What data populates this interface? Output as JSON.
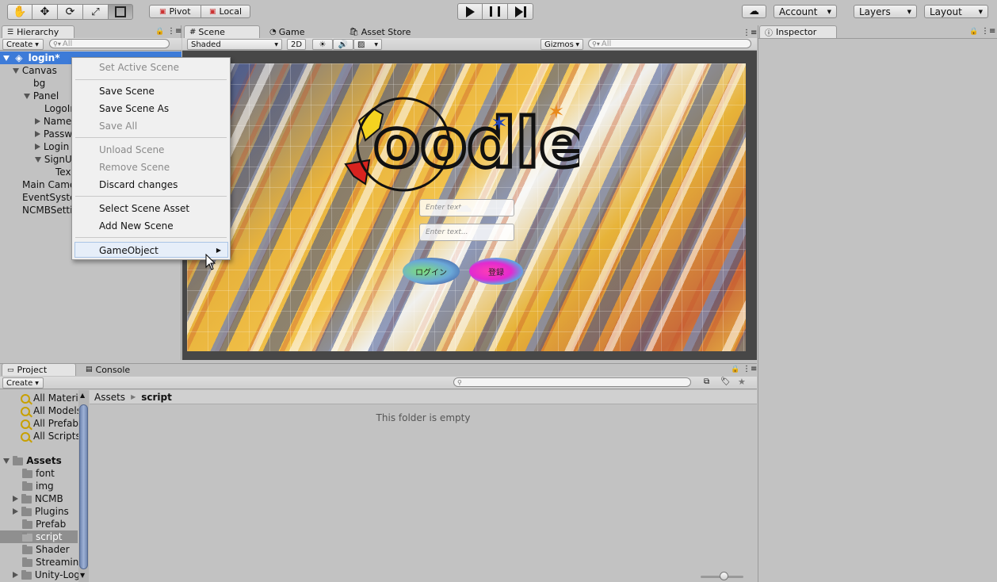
{
  "toolbar": {
    "pivot": "Pivot",
    "local": "Local",
    "account": "Account",
    "layers": "Layers",
    "layout": "Layout"
  },
  "hierarchy": {
    "tab": "Hierarchy",
    "create": "Create",
    "search_placeholder": "All",
    "scene": "login*",
    "items": [
      "Canvas",
      "bg",
      "Panel",
      "LogoIm",
      "Name",
      "Passw",
      "Login",
      "SignU",
      "Tex",
      "Main Came",
      "EventSyste",
      "NCMBSettin"
    ]
  },
  "context_menu": {
    "items": [
      "Set Active Scene",
      "Save Scene",
      "Save Scene As",
      "Save All",
      "Unload Scene",
      "Remove Scene",
      "Discard changes",
      "Select Scene Asset",
      "Add New Scene",
      "GameObject"
    ]
  },
  "scene_view": {
    "tabs": [
      "Scene",
      "Game",
      "Asset Store"
    ],
    "shading": "Shaded",
    "mode_2d": "2D",
    "gizmos": "Gizmos",
    "search_placeholder": "All",
    "logo": "oodle",
    "input1_placeholder": "Enter text...",
    "input2_placeholder": "Enter text...",
    "login_button": "ログイン",
    "signup_button": "登録"
  },
  "inspector": {
    "tab": "Inspector"
  },
  "project": {
    "tabs": [
      "Project",
      "Console"
    ],
    "create": "Create",
    "favorites": [
      "All Materi",
      "All Models",
      "All Prefab",
      "All Scripts"
    ],
    "assets_root": "Assets",
    "folders": [
      "font",
      "img",
      "NCMB",
      "Plugins",
      "Prefab",
      "script",
      "Shader",
      "Streamin",
      "Unity-Log"
    ],
    "breadcrumb": [
      "Assets",
      "script"
    ],
    "empty_message": "This folder is empty"
  },
  "colors": {
    "accent": "#3d7bd8",
    "menu_bg": "#f0f0f0"
  }
}
